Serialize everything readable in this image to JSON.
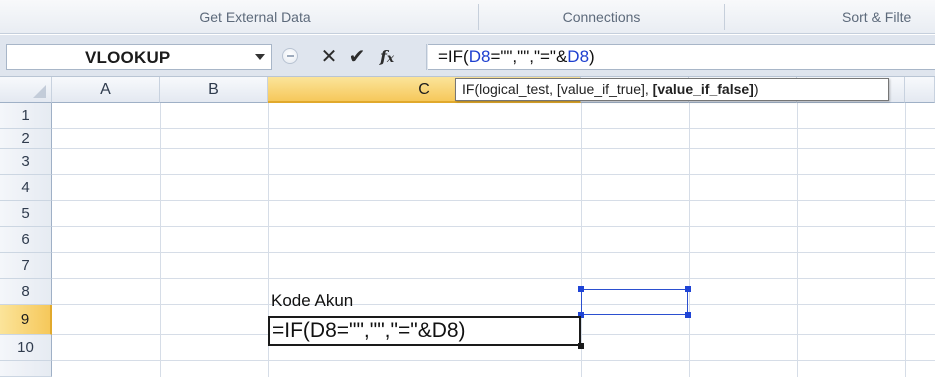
{
  "ribbon": {
    "groups": [
      "Get External Data",
      "Connections",
      "Sort & Filte"
    ]
  },
  "formula_bar": {
    "name_box": "VLOOKUP",
    "formula_prefix": "=IF(",
    "formula_ref1": "D8",
    "formula_middle": "=\"\",\"\",\"=\"&",
    "formula_ref2": "D8",
    "formula_suffix": ")",
    "cancel_icon": "cross-icon",
    "enter_icon": "check-icon",
    "function_icon": "fx-icon"
  },
  "tooltip": {
    "func": "IF(",
    "args": "logical_test, [value_if_true], ",
    "bold_arg": "[value_if_false]",
    "close": ")"
  },
  "sheet": {
    "columns": [
      "A",
      "B",
      "C",
      "",
      "",
      "",
      ""
    ],
    "rows": [
      "1",
      "2",
      "3",
      "4",
      "5",
      "6",
      "7",
      "8",
      "9",
      "10"
    ],
    "selected_column": "C",
    "selected_row": "9",
    "cells": {
      "C8": "Kode Akun",
      "C9": "=IF(D8=\"\",\"\",\"=\"&D8)"
    }
  },
  "colors": {
    "reference": "#1d3fcf",
    "selection_header": "#f6c85b"
  }
}
